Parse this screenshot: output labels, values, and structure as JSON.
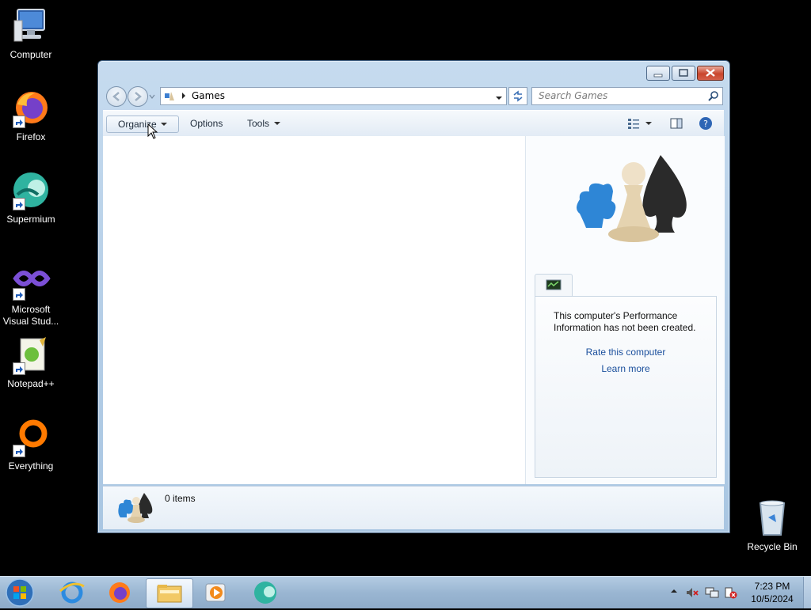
{
  "desktop": {
    "icons": [
      {
        "label": "Computer"
      },
      {
        "label": "Firefox"
      },
      {
        "label": "Supermium"
      },
      {
        "label": "Microsoft Visual Stud..."
      },
      {
        "label": "Notepad++"
      },
      {
        "label": "Everything"
      },
      {
        "label": "Recycle Bin"
      }
    ]
  },
  "window": {
    "address": {
      "location": "Games"
    },
    "search": {
      "placeholder": "Search Games"
    },
    "toolbar": {
      "organize": "Organize",
      "options": "Options",
      "tools": "Tools"
    },
    "perf_panel": {
      "message": "This computer's Performance Information has not been created.",
      "rate_link": "Rate this computer",
      "learn_link": "Learn more"
    },
    "details": {
      "item_count": "0 items"
    }
  },
  "taskbar": {
    "time": "7:23 PM",
    "date": "10/5/2024"
  },
  "colors": {
    "link": "#1a4f9c",
    "window_frame": "#b3cde6",
    "taskbar": "#9ab6d2"
  }
}
